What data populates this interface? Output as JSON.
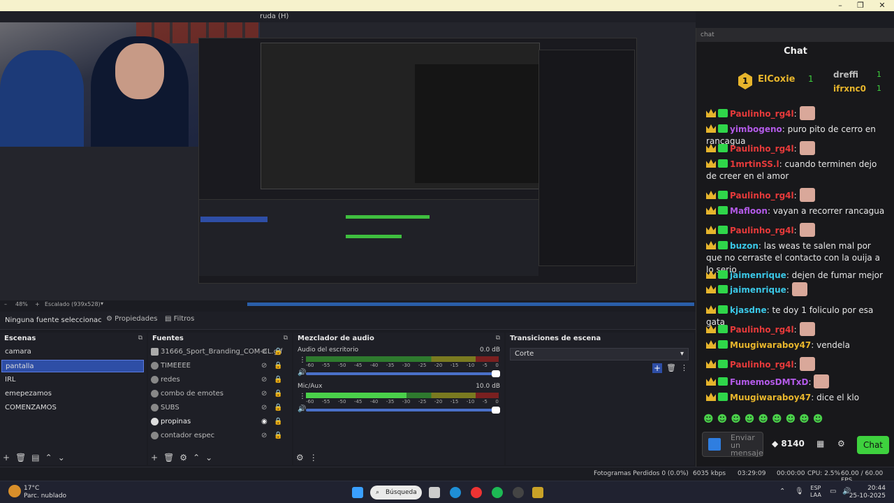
{
  "window": {
    "title_fragment": "ruda (H)",
    "minimize": "–",
    "maximize": "❐",
    "close": "✕"
  },
  "preview": {
    "zoom": "48%",
    "scale_label": "Escalado (939x528)"
  },
  "properties_bar": {
    "no_source": "Ninguna fuente seleccionac",
    "properties": "Propiedades",
    "filters": "Filtros"
  },
  "scenes": {
    "title": "Escenas",
    "items": [
      "camara",
      "pantalla",
      "IRL",
      "emepezamos",
      "COMENZAMOS"
    ],
    "selected": "pantalla"
  },
  "sources": {
    "title": "Fuentes",
    "items": [
      "31666_Sport_Branding_COM-CL.gif",
      "TIMEEEE",
      "redes",
      "combo de emotes",
      "SUBS",
      "propinas",
      "contador espec"
    ]
  },
  "mixer": {
    "title": "Mezclador de audio",
    "channels": [
      {
        "name": "Audio del escritorio",
        "db": "0.0 dB",
        "level": 0.0
      },
      {
        "name": "Mic/Aux",
        "db": "10.0 dB",
        "level": 0.52
      }
    ],
    "ticks": [
      "-60",
      "-55",
      "-50",
      "-45",
      "-40",
      "-35",
      "-30",
      "-25",
      "-20",
      "-15",
      "-10",
      "-5",
      "0"
    ]
  },
  "transitions": {
    "title": "Transiciones de escena",
    "selected": "Corte"
  },
  "statusbar": {
    "dropped": "Fotogramas Perdidos 0 (0.0%)",
    "bitrate": "6035 kbps",
    "rec_time": "03:29:09",
    "stream_time": "00:00:00",
    "cpu": "CPU: 2.5%",
    "fps": "60.00 / 60.00 FPS"
  },
  "taskbar": {
    "temp": "17°C",
    "weather": "Parc. nublado",
    "search": "Búsqueda",
    "lang1": "ESP",
    "lang2": "LAA",
    "time": "20:44",
    "date": "25-10-2025"
  },
  "chat": {
    "url": "chat",
    "header": "Chat",
    "gifters": [
      {
        "rank": "1",
        "name": "ElCoxie",
        "count": "1"
      },
      {
        "rank": "2",
        "name": "dreffi",
        "count": "1"
      },
      {
        "rank": "3",
        "name": "ifrxnc0",
        "count": "1"
      }
    ],
    "messages": [
      {
        "user": "Paulinho_rg4l",
        "color": "#e63a3a",
        "text": ""
      },
      {
        "user": "yimbogeno",
        "color": "#b35ae8",
        "text": "puro pito de cerro en rancagua"
      },
      {
        "user": "Paulinho_rg4l",
        "color": "#e63a3a",
        "text": ""
      },
      {
        "user": "1mrtinSS.l",
        "color": "#e63a3a",
        "text": "cuando terminen dejo de creer en el amor"
      },
      {
        "user": "Paulinho_rg4l",
        "color": "#e63a3a",
        "text": ""
      },
      {
        "user": "Mafloon",
        "color": "#b35ae8",
        "text": "vayan a recorrer rancagua"
      },
      {
        "user": "Paulinho_rg4l",
        "color": "#e63a3a",
        "text": ""
      },
      {
        "user": "buzon",
        "color": "#3ac7e6",
        "text": "las weas te salen mal por que no cerraste el contacto con la ouija a lo serio"
      },
      {
        "user": "jaimenrique",
        "color": "#3ac7e6",
        "text": "dejen de fumar mejor"
      },
      {
        "user": "jaimenrique",
        "color": "#3ac7e6",
        "text": ""
      },
      {
        "user": "kjasdne",
        "color": "#3ac7e6",
        "text": "te doy 1 foliculo por esa gata"
      },
      {
        "user": "Paulinho_rg4l",
        "color": "#e63a3a",
        "text": ""
      },
      {
        "user": "Muugiwaraboy47",
        "color": "#e7b52c",
        "text": "vendela"
      },
      {
        "user": "Paulinho_rg4l",
        "color": "#e63a3a",
        "text": ""
      },
      {
        "user": "FumemosDMTxD",
        "color": "#b35ae8",
        "text": ""
      },
      {
        "user": "Muugiwaraboy47",
        "color": "#e7b52c",
        "text": "dice el klo"
      }
    ],
    "input_placeholder": "Enviar un mensaje",
    "points": "8140",
    "chat_button": "Chat"
  }
}
